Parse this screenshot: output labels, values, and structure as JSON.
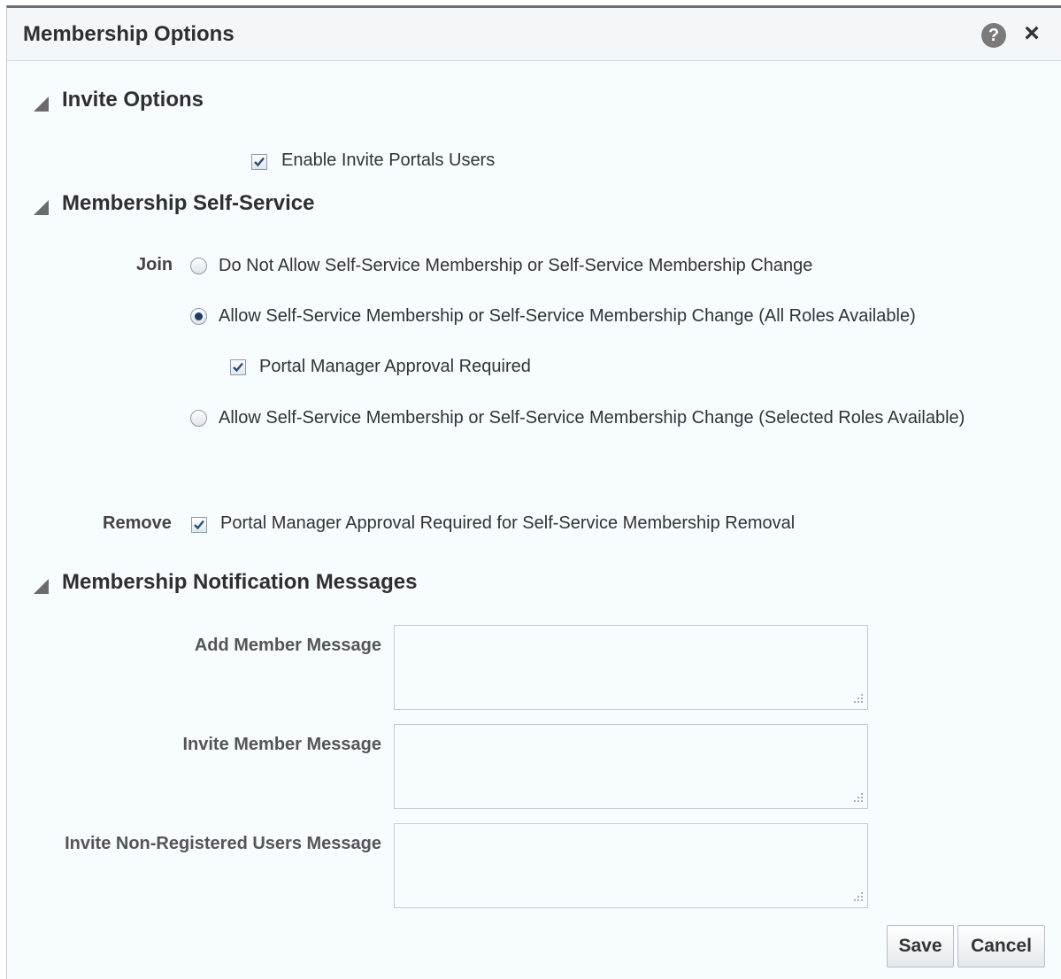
{
  "dialog": {
    "title": "Membership Options",
    "help_glyph": "?",
    "close_glyph": "×"
  },
  "sections": {
    "invite": {
      "title": "Invite Options",
      "enable_invite_label": "Enable Invite Portals Users",
      "enable_invite_checked": true
    },
    "self_service": {
      "title": "Membership Self-Service",
      "join_label": "Join",
      "options": [
        {
          "label": "Do Not Allow Self-Service Membership or Self-Service Membership Change",
          "selected": false
        },
        {
          "label": "Allow Self-Service Membership or Self-Service Membership Change (All Roles Available)",
          "selected": true
        },
        {
          "label": "Allow Self-Service Membership or Self-Service Membership Change (Selected Roles Available)",
          "selected": false
        }
      ],
      "approval_label": "Portal Manager Approval Required",
      "approval_checked": true,
      "remove_label": "Remove",
      "remove_option_label": "Portal Manager Approval Required for Self-Service Membership Removal",
      "remove_checked": true
    },
    "notifications": {
      "title": "Membership Notification Messages",
      "fields": [
        {
          "label": "Add Member Message",
          "value": ""
        },
        {
          "label": "Invite Member Message",
          "value": ""
        },
        {
          "label": "Invite Non-Registered Users Message",
          "value": ""
        }
      ]
    }
  },
  "buttons": {
    "save": "Save",
    "cancel": "Cancel"
  },
  "icons": {
    "help": "help-icon",
    "close": "close-icon",
    "collapse": "collapse-triangle-icon"
  },
  "colors": {
    "background": "#f6fcff",
    "checkmark": "#2a4f7a",
    "radio_selected": "#1c3e63"
  }
}
